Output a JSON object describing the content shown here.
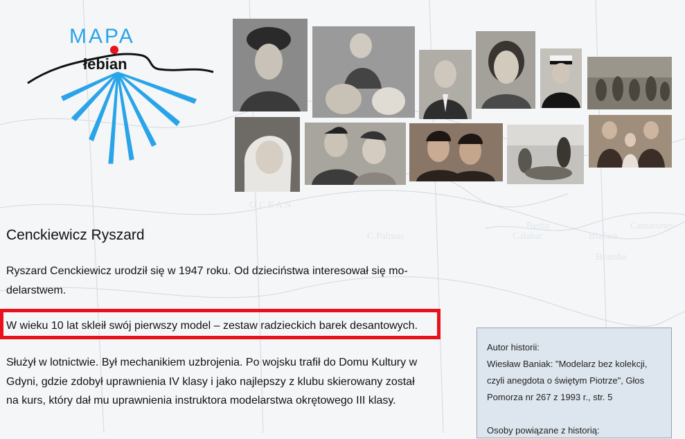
{
  "logo": {
    "title": "MAPA",
    "subtitle": "łebian",
    "accent_color": "#2aa4e8",
    "marker_color": "#e8111c"
  },
  "photos": [
    "portrait-woman-hat",
    "woman-with-dogs",
    "portrait-older-man",
    "portrait-young-woman",
    "portrait-sailor-cap",
    "group-outdoor",
    "portrait-woman-headscarf",
    "couple-portrait",
    "two-women-portrait",
    "beach-scene",
    "family-portrait"
  ],
  "article": {
    "title": "Cenckiewicz Ryszard",
    "p1": "Ryszard Cenckiewicz urodził się w 1947 roku. Od dzieciństwa interesował się mo-delarstwem.",
    "p1_line1": "Ryszard Cenckiewicz urodził się w 1947 roku. Od dzieciństwa interesował się mo-",
    "p1_line2": "delarstwem.",
    "p2": "W wieku 10 lat skleił swój pierwszy model – zestaw radzieckich barek desantowych.",
    "p3_line1": "Służył w lotnictwie. Był mechanikiem uzbrojenia. Po wojsku trafił do Domu Kultury w",
    "p3_line2": "Gdyni, gdzie zdobył uprawnienia IV klasy i jako najlepszy z klubu skierowany został",
    "p3_line3": "na kurs, który dał mu uprawnienia instruktora modelarstwa okrętowego III klasy.",
    "highlight_color": "#e8111c"
  },
  "sidebar": {
    "author_label": "Autor historii:",
    "source_line1": "Wiesław Baniak: \"Modelarz bez kolekcji,",
    "source_line2": "czyli anegdota o świętym Piotrze\", Głos",
    "source_line3": "Pomorza nr 267 z 1993 r., str. 5",
    "related_label": "Osoby powiązane z historią:"
  }
}
